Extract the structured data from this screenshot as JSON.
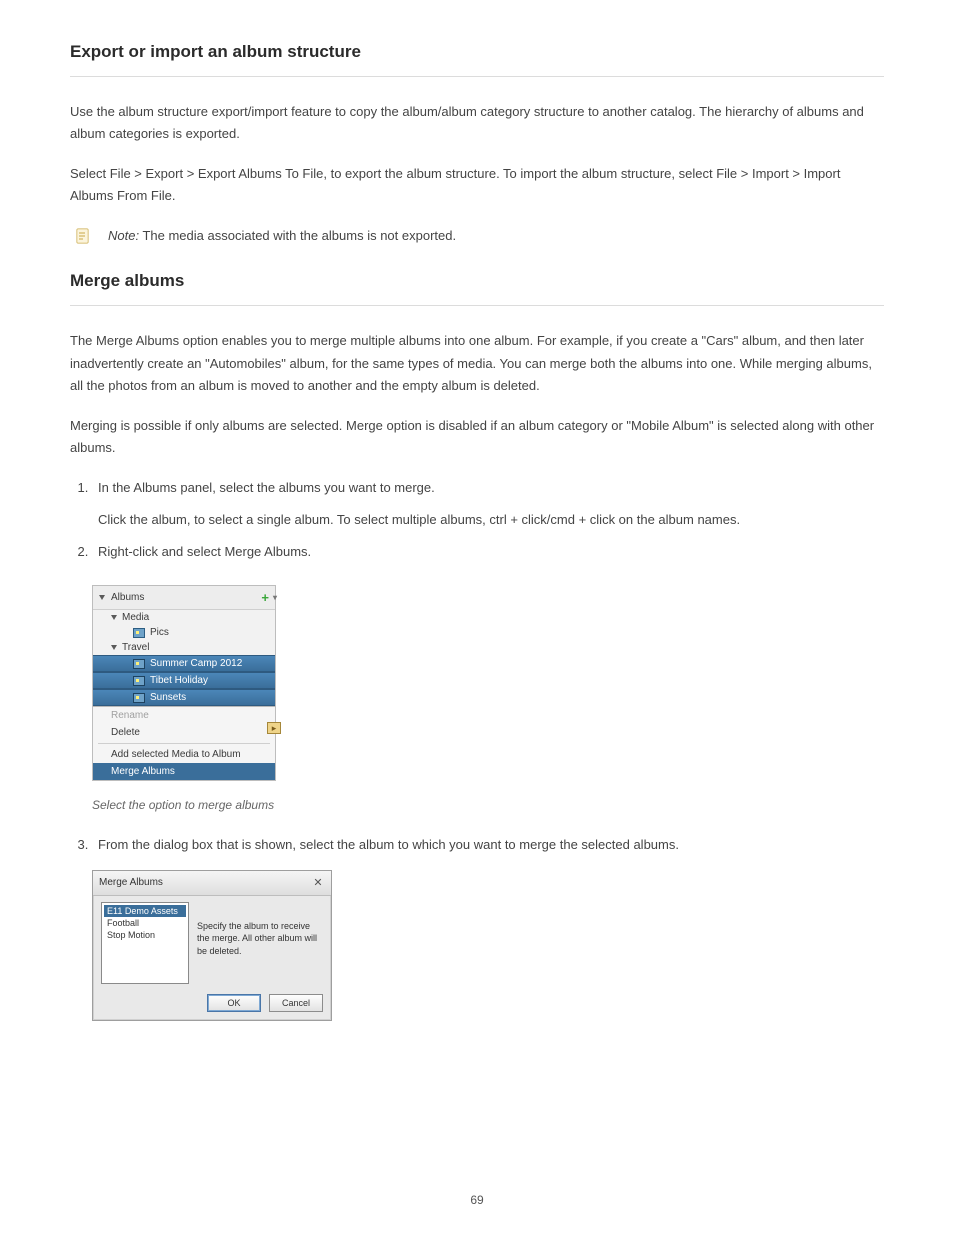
{
  "section1": {
    "title": "Export or import an album structure",
    "p1": "Use the album structure export/import feature to copy the album/album category structure to another catalog. The hierarchy of albums and album categories is exported.",
    "p2": "Select File > Export > Export Albums To File, to export the album structure. To import the album structure, select File > Import > Import Albums From File.",
    "note_icon_label": "note-icon",
    "note_text": "The media associated with the albums is not exported."
  },
  "section2": {
    "title": "Merge albums",
    "p1": "The Merge Albums option enables you to merge multiple albums into one album. For example, if you create a \"Cars\" album, and then later inadvertently create an \"Automobiles\" album, for the same types of media. You can merge both the albums into one. While merging albums, all the photos from an album is moved to another and the empty album is deleted.",
    "p2": "Merging is possible if only albums are selected. Merge option is disabled if an album category or \"Mobile Album\" is selected along with other albums.",
    "step1": "In the Albums panel, select the albums you want to merge.",
    "step1b": "Click the album, to select a single album. To select multiple albums, ctrl + click/cmd + click on the album names.",
    "step2": "Right-click and select Merge Albums."
  },
  "albums_tree": {
    "header": "Albums",
    "row_media": "Media",
    "row_pics": "Pics",
    "row_travel": "Travel",
    "row_summer": "Summer Camp 2012",
    "row_tibet": "Tibet Holiday",
    "row_sunsets": "Sunsets",
    "ctx_rename": "Rename",
    "ctx_delete": "Delete",
    "ctx_addmedia": "Add selected Media to Album",
    "ctx_merge": "Merge Albums"
  },
  "caption1": "Select the option to merge albums",
  "step3": "From the dialog box that is shown, select the album to which you want to merge the selected albums.",
  "merge_dialog": {
    "title": "Merge Albums",
    "list_item1": "E11 Demo Assets",
    "list_item2": "Football",
    "list_item3": "Stop Motion",
    "desc": "Specify the album to receive the merge. All other album will be deleted.",
    "ok": "OK",
    "cancel": "Cancel"
  },
  "page_num": "69"
}
